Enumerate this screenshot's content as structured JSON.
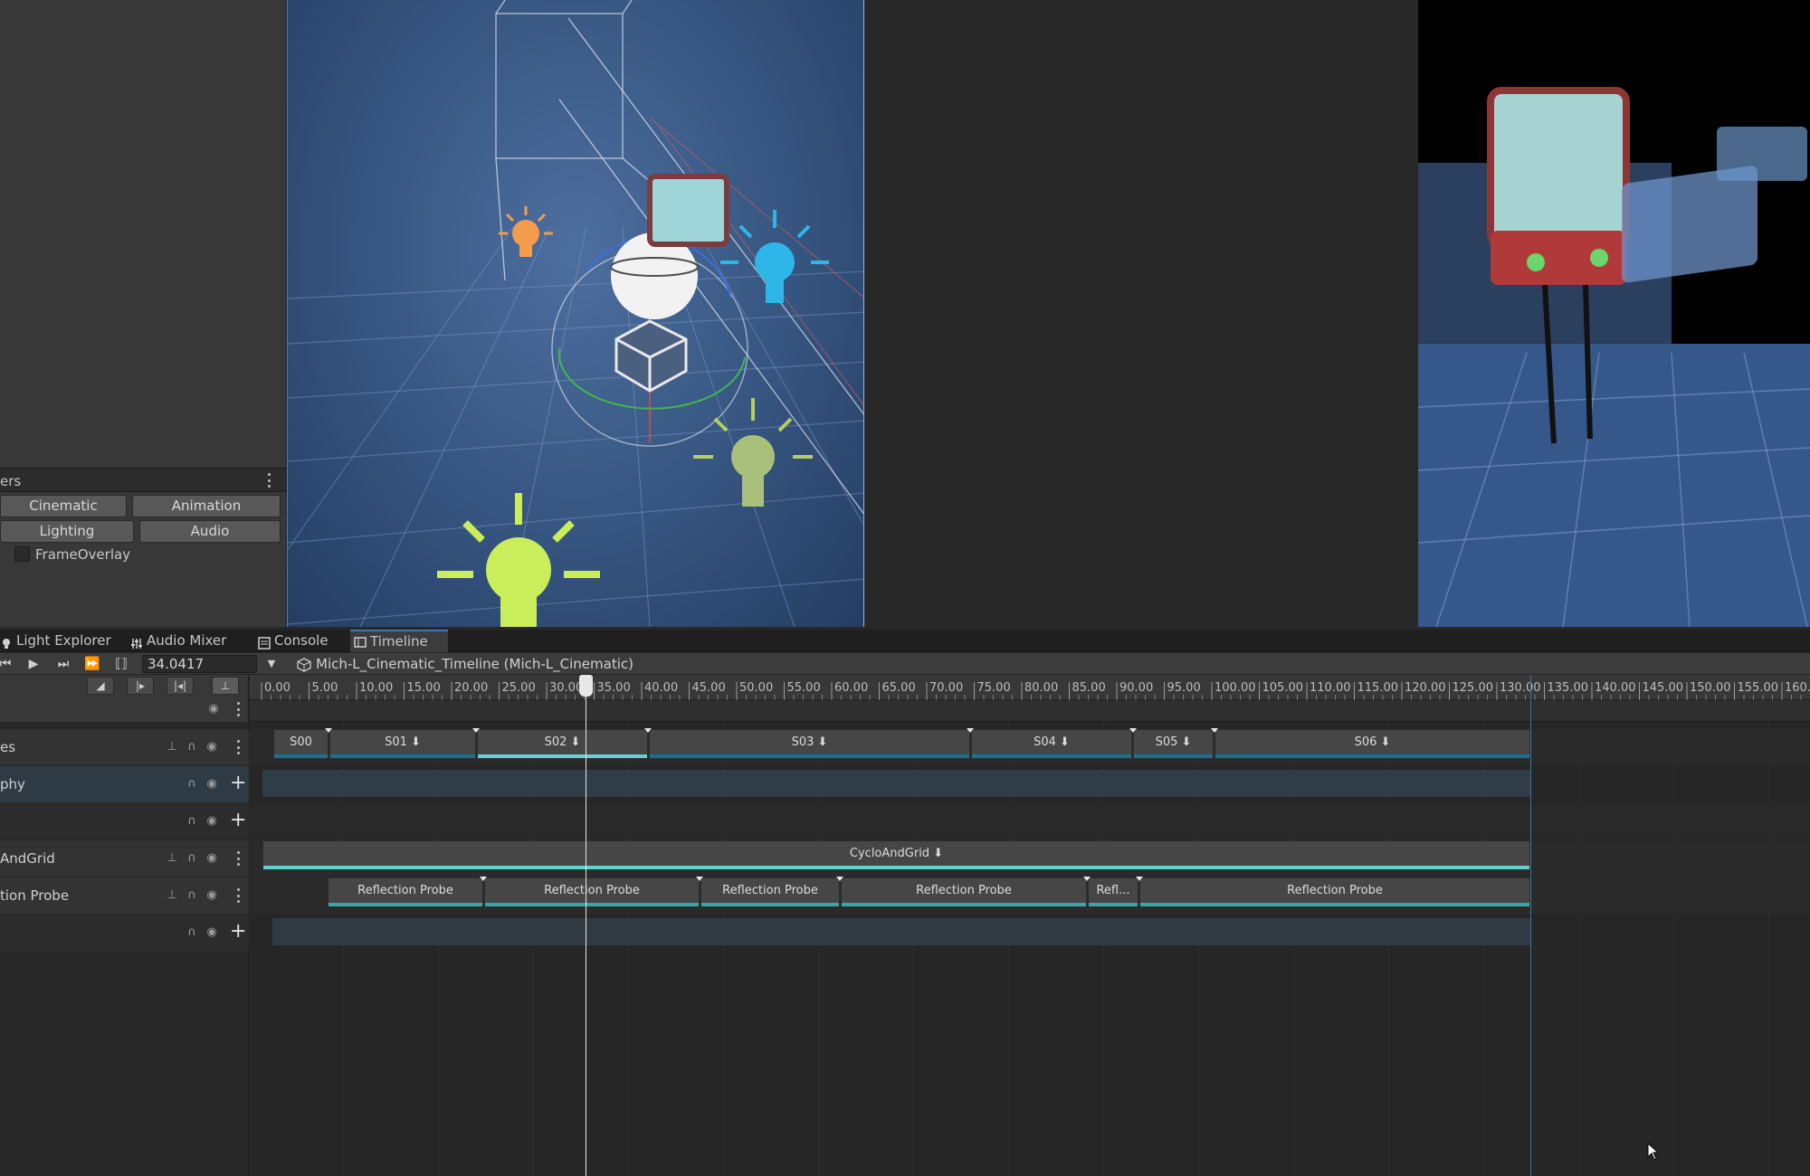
{
  "layers_panel": {
    "title": "ers",
    "buttons": [
      "Cinematic",
      "Animation",
      "Lighting",
      "Audio"
    ],
    "checkbox_label": "FrameOverlay"
  },
  "tabs": [
    {
      "label": "Light Explorer",
      "icon": "bulb-icon"
    },
    {
      "label": "Audio Mixer",
      "icon": "mixer-icon"
    },
    {
      "label": "Console",
      "icon": "console-icon"
    },
    {
      "label": "Timeline",
      "icon": "timeline-icon",
      "active": true
    }
  ],
  "toolbar": {
    "current_time": "34.0417",
    "breadcrumb": "Mich-L_Cinematic_Timeline (Mich-L_Cinematic)"
  },
  "ruler": {
    "ticks": [
      "0.00",
      "5.00",
      "10.00",
      "15.00",
      "20.00",
      "25.00",
      "30.00",
      "35.00",
      "40.00",
      "45.00",
      "50.00",
      "55.00",
      "60.00",
      "65.00",
      "70.00",
      "75.00",
      "80.00",
      "85.00",
      "90.00",
      "95.00",
      "100.00",
      "105.00",
      "110.00",
      "115.00",
      "120.00",
      "125.00",
      "130.00",
      "135.00",
      "140.00",
      "145.00",
      "150.00",
      "155.00",
      "160."
    ]
  },
  "tracks": [
    {
      "name": "es",
      "clips": [
        "S00",
        "S01",
        "S02",
        "S03",
        "S04",
        "S05",
        "S06"
      ]
    },
    {
      "name": "phy"
    },
    {
      "name": ""
    },
    {
      "name": "AndGrid",
      "clips": [
        "CycloAndGrid"
      ]
    },
    {
      "name": "tion Probe",
      "clips": [
        "Reflection Probe",
        "Reflection Probe",
        "Reflection Probe",
        "Reflection Probe",
        "Refl...",
        "Reflection Probe"
      ]
    },
    {
      "name": ""
    }
  ],
  "colors": {
    "accent_tab": "#3a79bb",
    "clip_bar": "#1e6f8c",
    "clip_selected": "#62d3cf"
  }
}
